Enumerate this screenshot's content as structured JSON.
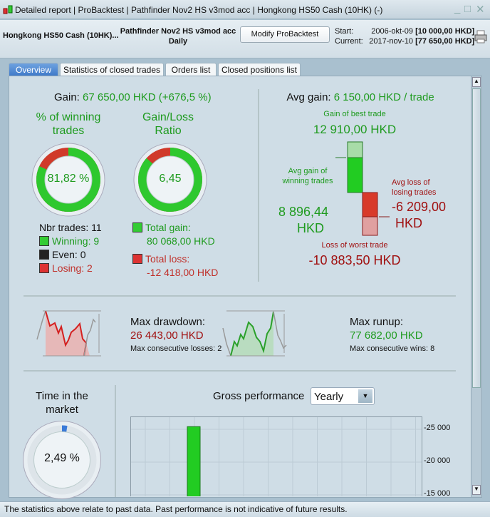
{
  "window": {
    "title_parts": [
      "Detailed report",
      "ProBacktest",
      "Pathfinder Nov2 HS v3mod acc",
      "Hongkong HS50 Cash (10HK) (-)"
    ],
    "controls": [
      "minimize",
      "maximize",
      "close"
    ]
  },
  "header": {
    "instrument": "Hongkong HS50 Cash (10HK)...",
    "strategy": "Pathfinder Nov2 HS v3mod acc",
    "period": "Daily",
    "modify_label": "Modify ProBacktest",
    "start_label": "Start:",
    "start_date": "2006-okt-09",
    "start_value": "[10 000,00 HKD]",
    "current_label": "Current:",
    "current_date": "2017-nov-10",
    "current_value": "[77 650,00 HKD]"
  },
  "tabs": [
    {
      "label": "Overview",
      "active": true
    },
    {
      "label": "Statistics of closed trades"
    },
    {
      "label": "Orders list"
    },
    {
      "label": "Closed positions list"
    }
  ],
  "gain": {
    "label": "Gain:",
    "value": "67 650,00 HKD (+676,5 %)"
  },
  "winning": {
    "title1": "% of winning",
    "title2": "trades",
    "value": "81,82 %",
    "percent": 81.82
  },
  "ratio": {
    "title1": "Gain/Loss",
    "title2": "Ratio",
    "value": "6,45",
    "win_fraction": 0.866
  },
  "trades": {
    "nbr": "Nbr trades: 11",
    "winning": "Winning: 9",
    "even": "Even: 0",
    "losing": "Losing: 2"
  },
  "totals": {
    "gain_label": "Total gain:",
    "gain": "80 068,00 HKD",
    "loss_label": "Total loss:",
    "loss": "-12 418,00 HKD"
  },
  "avg": {
    "label": "Avg gain:",
    "value": "6 150,00 HKD / trade",
    "best_label": "Gain of best trade",
    "best": "12 910,00 HKD",
    "avg_win_label1": "Avg gain of",
    "avg_win_label2": "winning trades",
    "avg_win1": "8 896,44",
    "avg_win2": "HKD",
    "avg_loss_label1": "Avg loss of",
    "avg_loss_label2": "losing trades",
    "avg_loss1": "-6 209,00",
    "avg_loss2": "HKD",
    "worst_label": "Loss of worst trade",
    "worst": "-10 883,50 HKD"
  },
  "drawdown": {
    "label": "Max drawdown:",
    "value": "26 443,00 HKD",
    "sub": "Max consecutive losses: 2"
  },
  "runup": {
    "label": "Max runup:",
    "value": "77 682,00 HKD",
    "sub": "Max consecutive wins: 8"
  },
  "time_market": {
    "title1": "Time in the",
    "title2": "market",
    "value": "2,49 %",
    "percent": 2.49
  },
  "gross": {
    "label": "Gross performance",
    "select": "Yearly"
  },
  "chart_data": {
    "type": "bar",
    "values": [
      25400
    ],
    "yticks": [
      25000,
      20000,
      15000
    ],
    "ylim": [
      14500,
      27000
    ],
    "grid": true,
    "colors": {
      "positive": "#22cc22"
    }
  },
  "footer": "The statistics above relate to past data. Past performance is not indicative of future results.",
  "colors": {
    "green": "#1f9b1f",
    "red": "#a01010",
    "accent": "#3d78c8"
  }
}
